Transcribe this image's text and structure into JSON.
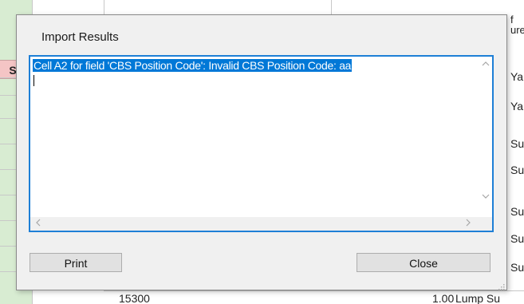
{
  "background": {
    "left_column_header": "Soil",
    "right_column_header_partial": [
      "f",
      "ure"
    ],
    "right_column_cells": [
      "Ya",
      "Ya",
      "Su",
      "Su",
      "Su",
      "Su",
      "Su"
    ],
    "bottom_row": {
      "code": "15300",
      "quantity": "1.00",
      "unit": "Lump Su"
    }
  },
  "dialog": {
    "title": "Import Results",
    "results_text": "Cell A2 for field 'CBS Position Code': Invalid CBS Position Code: aa",
    "print_label": "Print",
    "close_label": "Close"
  },
  "colors": {
    "selection": "#0078d7",
    "focus_border": "#1e7fd6",
    "header_pink": "#f4c5c5",
    "column_green": "#d8ecd2"
  }
}
